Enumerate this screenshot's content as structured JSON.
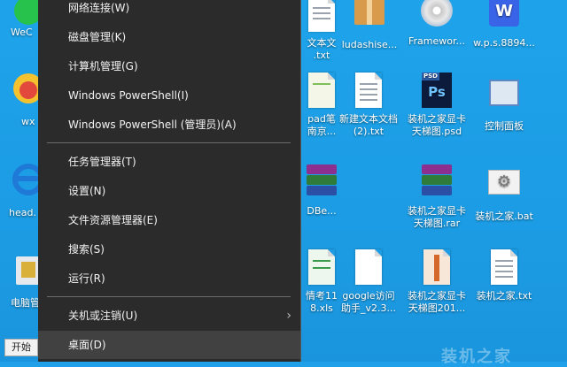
{
  "menu": {
    "items": [
      {
        "label": "网络连接(W)"
      },
      {
        "label": "磁盘管理(K)"
      },
      {
        "label": "计算机管理(G)"
      },
      {
        "label": "Windows PowerShell(I)"
      },
      {
        "label": "Windows PowerShell (管理员)(A)"
      },
      {
        "label": "任务管理器(T)"
      },
      {
        "label": "设置(N)"
      },
      {
        "label": "文件资源管理器(E)"
      },
      {
        "label": "搜索(S)"
      },
      {
        "label": "运行(R)"
      },
      {
        "label": "关机或注销(U)"
      },
      {
        "label": "桌面(D)"
      }
    ],
    "highlighted": "桌面(D)"
  },
  "taskbar": {
    "start_label": "开始"
  },
  "desktop": {
    "left_labels": [
      "WeC",
      "wx",
      "head.",
      "电脑管"
    ],
    "icons": [
      {
        "label": "文本文",
        "label2": ".txt"
      },
      {
        "label": "ludashise..."
      },
      {
        "label": "Framewor..."
      },
      {
        "label": "w.p.s.8894..."
      },
      {
        "label": "pad笔",
        "label2": "南京..."
      },
      {
        "label": "新建文本文档",
        "label2": "(2).txt"
      },
      {
        "label": "装机之家显卡",
        "label2": "天梯图.psd"
      },
      {
        "label": "控制面板"
      },
      {
        "label": "DBe..."
      },
      {
        "label": "装机之家显卡",
        "label2": "天梯图.rar"
      },
      {
        "label": "装机之家.bat"
      },
      {
        "label": "情考11",
        "label2": "8.xls"
      },
      {
        "label": "google访问",
        "label2": "助手_v2.3..."
      },
      {
        "label": "装机之家显卡",
        "label2": "天梯图201..."
      },
      {
        "label": "装机之家.txt"
      }
    ],
    "watermark": "装机之家"
  }
}
